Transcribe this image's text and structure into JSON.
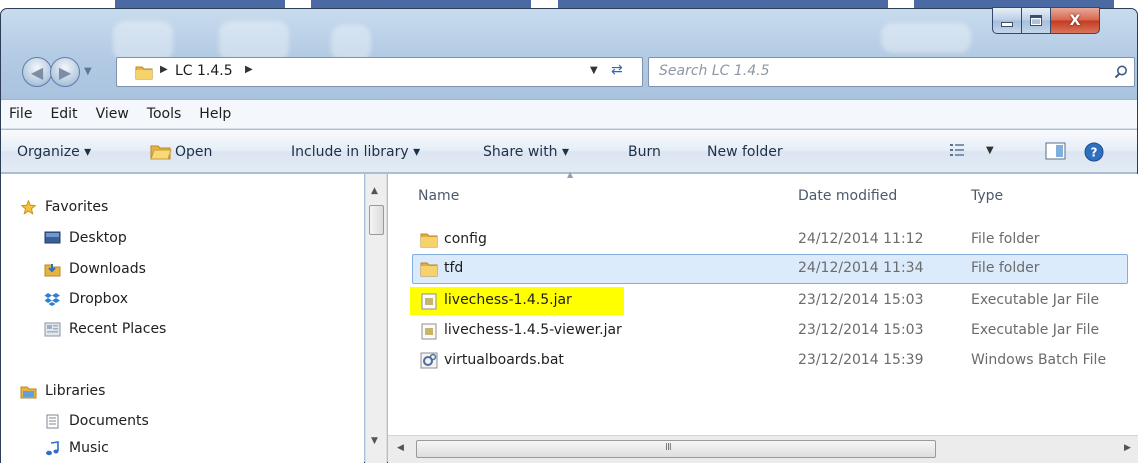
{
  "window": {
    "caption_minimize": "–",
    "caption_close": "X"
  },
  "address_bar": {
    "segments": [
      "LC 1.4.5"
    ],
    "search_placeholder": "Search LC 1.4.5"
  },
  "menu": [
    "File",
    "Edit",
    "View",
    "Tools",
    "Help"
  ],
  "toolbar": {
    "organize": "Organize ▾",
    "open": "Open",
    "include_in_library": "Include in library ▾",
    "share_with": "Share with ▾",
    "burn": "Burn",
    "new_folder": "New folder"
  },
  "nav": {
    "favorites_label": "Favorites",
    "favorites": [
      "Desktop",
      "Downloads",
      "Dropbox",
      "Recent Places"
    ],
    "libraries_label": "Libraries",
    "libraries": [
      "Documents",
      "Music"
    ]
  },
  "columns": {
    "name": "Name",
    "date": "Date modified",
    "type": "Type"
  },
  "files": [
    {
      "name": "config",
      "date": "24/12/2014 11:12",
      "type": "File folder",
      "icon": "folder-icon"
    },
    {
      "name": "tfd",
      "date": "24/12/2014 11:34",
      "type": "File folder",
      "icon": "folder-icon"
    },
    {
      "name": "livechess-1.4.5.jar",
      "date": "23/12/2014 15:03",
      "type": "Executable Jar File",
      "icon": "jar-file-icon"
    },
    {
      "name": "livechess-1.4.5-viewer.jar",
      "date": "23/12/2014 15:03",
      "type": "Executable Jar File",
      "icon": "jar-file-icon"
    },
    {
      "name": "virtualboards.bat",
      "date": "23/12/2014 15:39",
      "type": "Windows Batch File",
      "icon": "batch-file-icon"
    }
  ],
  "colors": {
    "highlight": "#ffff00",
    "selected_row": "#dcebfc",
    "selected_border": "#84acdd",
    "accent": "#2b4f93"
  }
}
